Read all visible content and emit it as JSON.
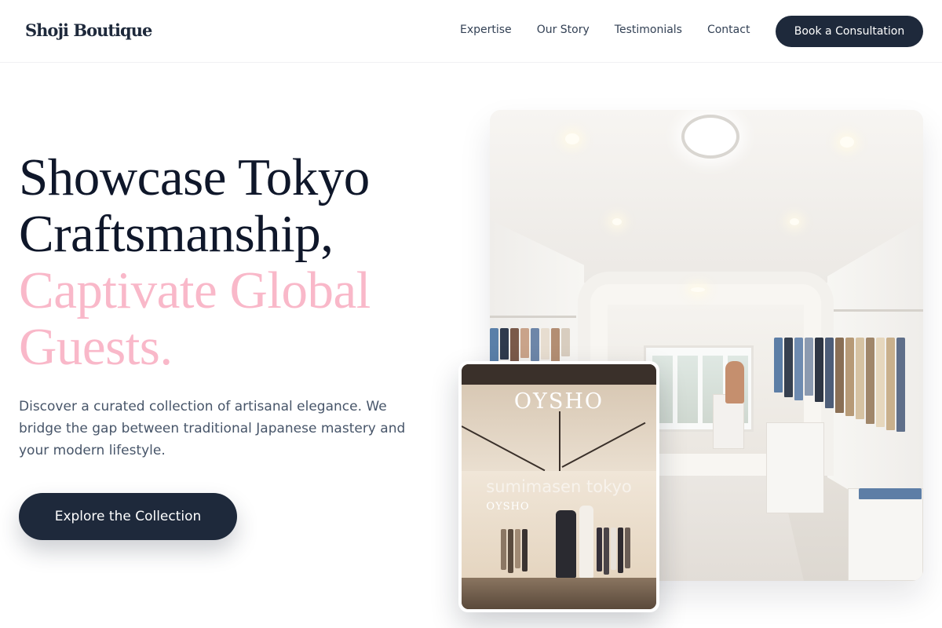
{
  "brand": {
    "name": "Shoji Boutique"
  },
  "nav": {
    "links": [
      "Expertise",
      "Our Story",
      "Testimonials",
      "Contact"
    ],
    "cta_label": "Book a Consultation"
  },
  "hero": {
    "title_line1": "Showcase Tokyo",
    "title_line2": "Craftsmanship,",
    "title_accent_line1": "Captivate Global",
    "title_accent_line2": "Guests.",
    "description": "Discover a curated collection of artisanal elegance. We bridge the gap between traditional Japanese mastery and your modern lifestyle.",
    "button_label": "Explore the Collection"
  },
  "images": {
    "storefront_brand": "OYSHO",
    "storefront_watermark": "sumimasen tokyo",
    "storefront_sign": "OYSHO"
  },
  "colors": {
    "primary": "#1e293b",
    "accent_pink": "#f9b8c9",
    "text_muted": "#475569"
  }
}
